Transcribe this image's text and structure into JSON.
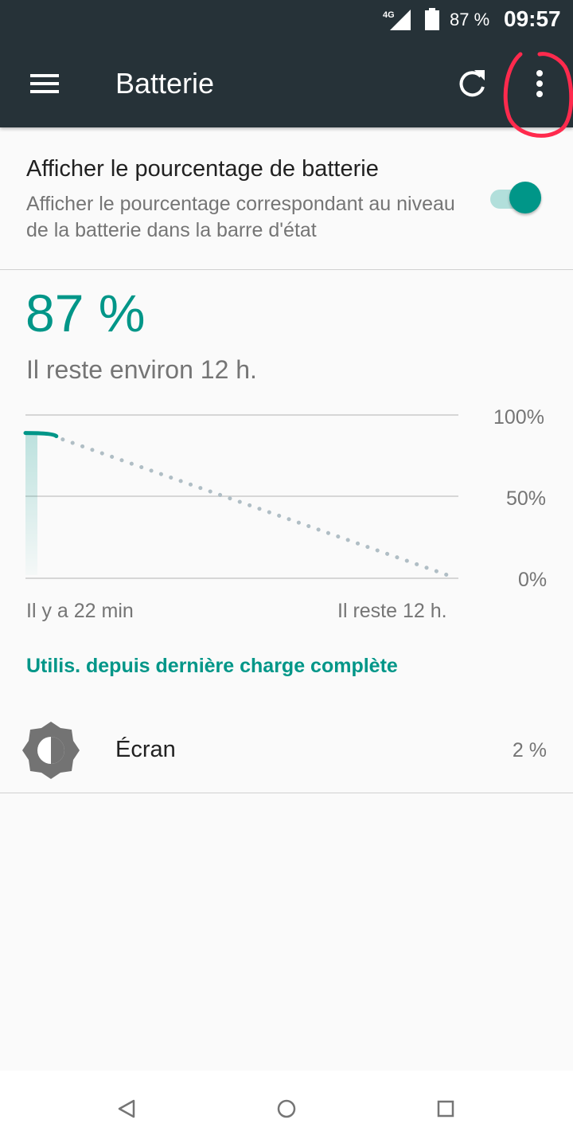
{
  "status_bar": {
    "network": "4G",
    "battery": "87 %",
    "time": "09:57",
    "icons": [
      "signal-4g-icon",
      "battery-icon"
    ]
  },
  "toolbar": {
    "title": "Batterie",
    "icons": [
      "menu-icon",
      "refresh-icon",
      "more-options-icon"
    ]
  },
  "battery_percentage_setting": {
    "title": "Afficher le pourcentage de batterie",
    "summary": "Afficher le pourcentage correspondant au niveau de la batterie dans la barre d'état",
    "enabled": true
  },
  "battery": {
    "level": "87 %",
    "remaining": "Il reste environ 12 h."
  },
  "chart_data": {
    "type": "line",
    "y_tick_labels": [
      "100%",
      "50%",
      "0%"
    ],
    "x_labels": [
      "Il y a 22 min",
      "Il reste 12 h."
    ],
    "ylim": [
      0,
      100
    ],
    "grid": true,
    "series": [
      {
        "kind": "history",
        "style": "solid",
        "color": "#009688",
        "points": [
          [
            0.0,
            87
          ],
          [
            0.6,
            87
          ]
        ]
      },
      {
        "kind": "projection",
        "style": "dotted",
        "color": "#b0bec5",
        "points": [
          [
            0.6,
            87
          ],
          [
            12.0,
            0
          ]
        ]
      }
    ]
  },
  "usage_section": {
    "title": "Utilis. depuis dernière charge complète",
    "items": [
      {
        "label": "Écran",
        "value": "2 %",
        "icon": "brightness-icon"
      }
    ]
  },
  "nav_bar": {
    "icons": [
      "back-icon",
      "home-icon",
      "recents-icon"
    ]
  },
  "colors": {
    "toolbar": "#263238",
    "accent": "#009688",
    "annotation": "#ff2a4d"
  }
}
